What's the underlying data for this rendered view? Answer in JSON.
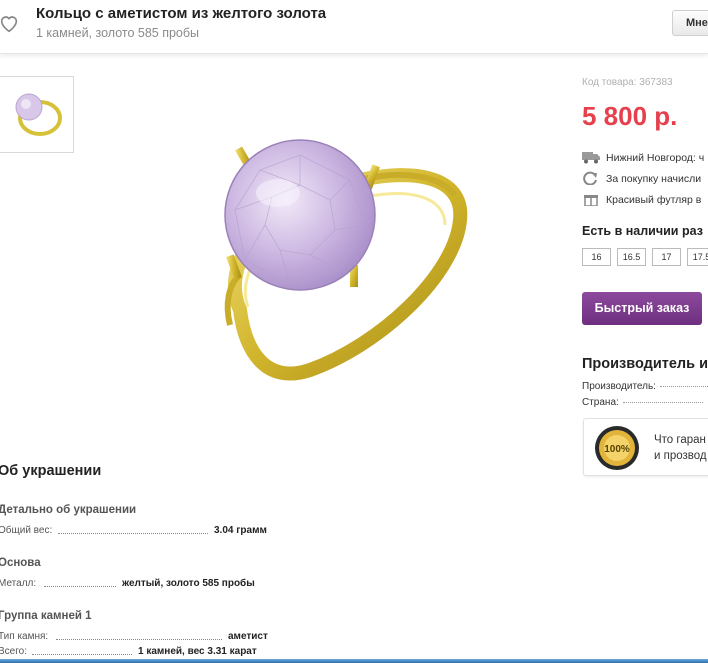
{
  "header": {
    "title": "Кольцо с аметистом из желтого золота",
    "subtitle": "1 камней, золото 585 пробы",
    "button_label": "Мне"
  },
  "product": {
    "code_label": "Код товара: 367383",
    "price": "5 800 р.",
    "features": [
      "Нижний Новгород: ч",
      "За покупку начисли",
      "Красивый футляр в"
    ],
    "sizes_title": "Есть в наличии раз",
    "sizes": [
      "16",
      "16.5",
      "17",
      "17.5"
    ],
    "quick_order_label": "Быстрый заказ"
  },
  "maker": {
    "title": "Производитель и",
    "rows": [
      {
        "label": "Производитель:"
      },
      {
        "label": "Страна:"
      }
    ],
    "guarantee_line1": "Что гаран",
    "guarantee_line2": "и прозвод"
  },
  "details": {
    "heading": "Об украшении",
    "sections": [
      {
        "title": "Детально об украшении",
        "rows": [
          {
            "label": "Общий вес:",
            "value": "3.04 грамм"
          }
        ]
      },
      {
        "title": "Основа",
        "rows": [
          {
            "label": "Металл:",
            "value": "желтый, золото 585 пробы"
          }
        ]
      },
      {
        "title": "Группа камней 1",
        "rows": [
          {
            "label": "Тип камня:",
            "value": "аметист"
          },
          {
            "label": "Всего:",
            "value": "1 камней, вес 3.31 карат"
          }
        ]
      }
    ]
  },
  "colors": {
    "price": "#e5404b",
    "button": "#7a3a8c",
    "gold": "#d9c23a",
    "amethyst": "#c9b3df"
  }
}
